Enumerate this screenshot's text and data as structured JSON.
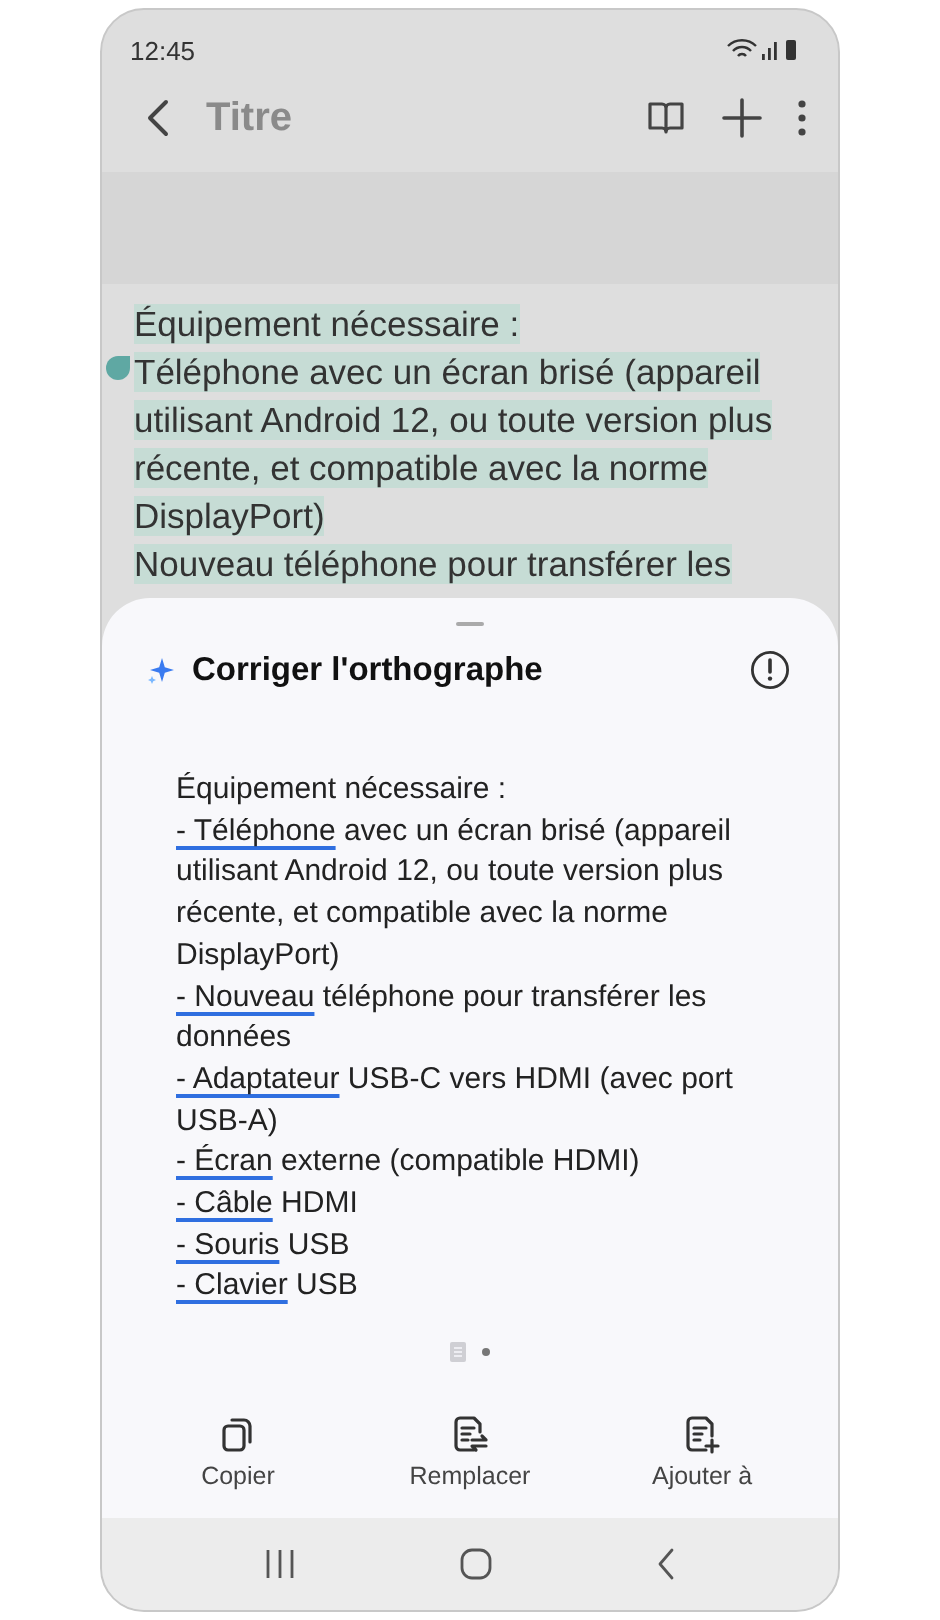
{
  "status_bar": {
    "time": "12:45"
  },
  "toolbar": {
    "title": "Titre"
  },
  "note": {
    "lines": [
      {
        "text": "Équipement nécessaire :",
        "highlighted": true
      },
      {
        "text": "Téléphone avec un écran brisé (appareil",
        "highlighted": true
      },
      {
        "text": "utilisant Android 12, ou toute version plus",
        "highlighted": true
      },
      {
        "text": "récente, et compatible avec la norme",
        "highlighted": true
      },
      {
        "text": "DisplayPort)",
        "highlighted": true
      },
      {
        "text": "Nouveau téléphone pour transférer les",
        "highlighted": true
      }
    ]
  },
  "sheet": {
    "title": "Corriger l'orthographe",
    "lines": [
      {
        "text": "Équipement nécessaire :"
      },
      {
        "corrected": "- Téléphone",
        "text": "avec un écran brisé (appareil utilisant Android 12, ou toute version plus récente, et compatible avec la norme DisplayPort)"
      },
      {
        "corrected": "- Nouveau",
        "text": "téléphone pour transférer les données"
      },
      {
        "corrected": "- Adaptateur",
        "text": "USB-C vers HDMI (avec port USB-A)"
      },
      {
        "corrected": "- Écran",
        "text": "externe (compatible HDMI)"
      },
      {
        "corrected": "- Câble",
        "text": "HDMI"
      },
      {
        "corrected": "- Souris",
        "text": "USB"
      },
      {
        "corrected": "- Clavier",
        "text": "USB"
      }
    ],
    "actions": [
      {
        "kind": "copy",
        "label": "Copier"
      },
      {
        "kind": "replace",
        "label": "Remplacer"
      },
      {
        "kind": "add",
        "label": "Ajouter à"
      }
    ]
  }
}
